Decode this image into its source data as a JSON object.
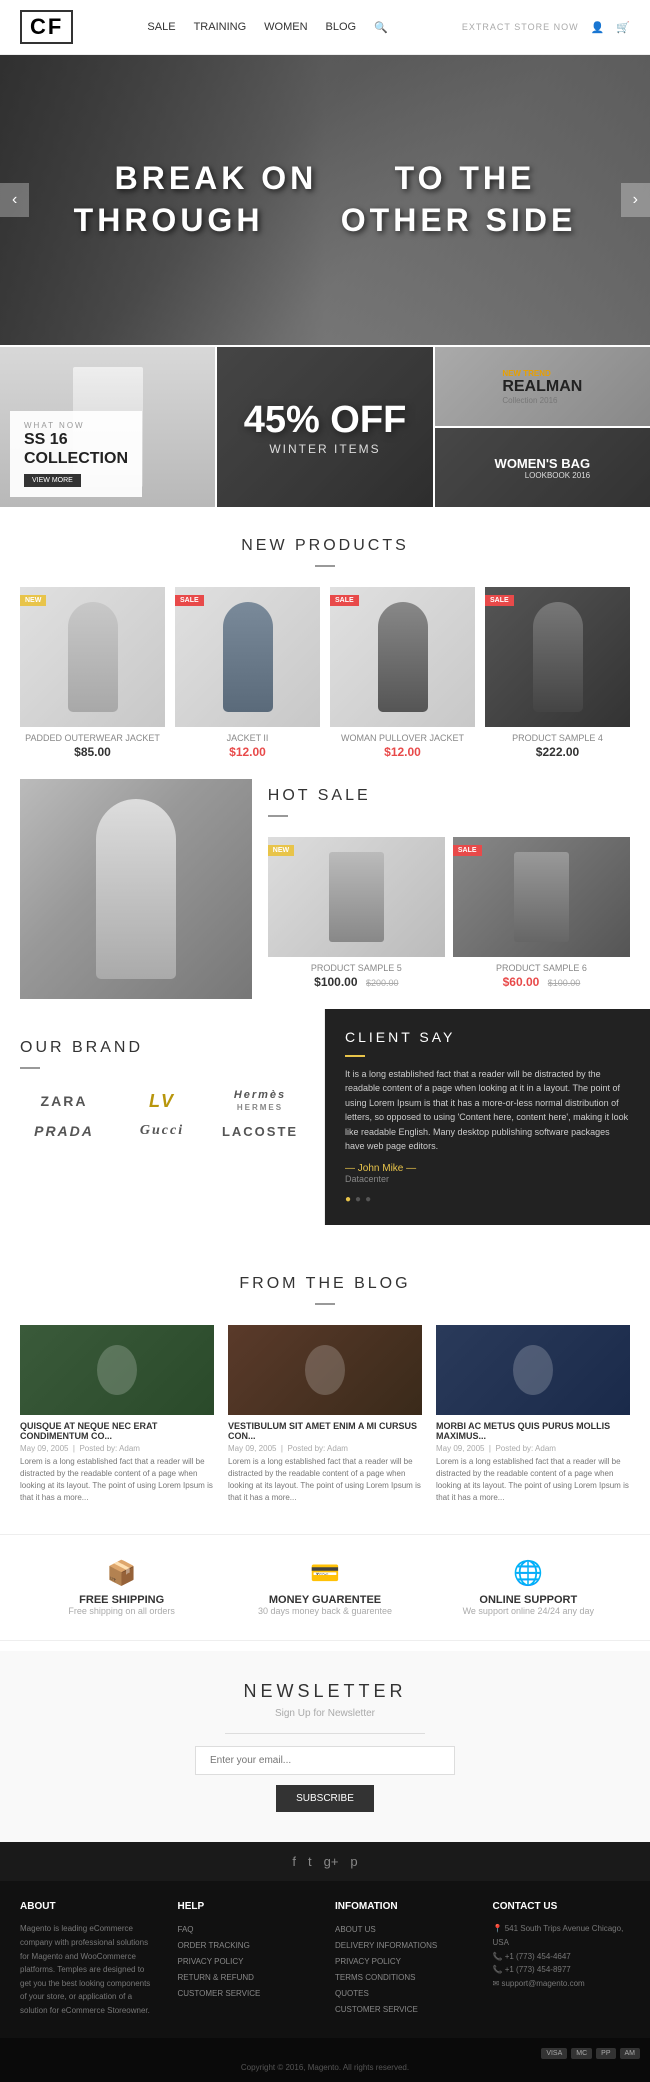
{
  "header": {
    "logo": "CF",
    "nav": [
      "SALE",
      "TRAINING",
      "WOMEN",
      "BLOG"
    ],
    "search_icon": "🔍",
    "right_links": [
      "EXTRACT STORE NOW"
    ],
    "user_icon": "👤",
    "cart_icon": "🛒"
  },
  "hero": {
    "line1": "BREAK ON",
    "line2": "TO THE",
    "line3": "THROUGH",
    "line4": "OTHER SIDE",
    "prev": "‹",
    "next": "›"
  },
  "promo": {
    "item1": {
      "badge": "WHAT NOW",
      "title": "SS 16\nCOLLECTION",
      "btn": "VIEW MORE"
    },
    "item2": {
      "percent": "45% OFF",
      "subtitle": "WINTER ITEMS"
    },
    "item3_top": {
      "new_trend": "NEW TREND",
      "title": "REALMAN",
      "subtitle": "Collection 2016"
    },
    "item3_bottom": {
      "title": "WOMEN'S BAG",
      "subtitle": "LOOKBOOK 2016"
    }
  },
  "new_products": {
    "title": "NEW PRODUCTS",
    "products": [
      {
        "name": "PADDED OUTERWEAR JACKET",
        "price": "$85.00",
        "sale": false,
        "tag": "NEW"
      },
      {
        "name": "JACKET II",
        "price": "$12.00",
        "sale": true,
        "tag": "SALE"
      },
      {
        "name": "WOMAN PULLOVER JACKET",
        "price": "$12.00",
        "sale": true,
        "tag": "SALE"
      },
      {
        "name": "PRODUCT SAMPLE 4",
        "price": "$222.00",
        "sale": false,
        "tag": "SALE"
      }
    ]
  },
  "hot_sale": {
    "title": "HOT SALE",
    "products": [
      {
        "name": "PRODUCT SAMPLE 5",
        "price": "$100.00",
        "old_price": "$200.00",
        "tag": "NEW"
      },
      {
        "name": "PRODUCT SAMPLE 6",
        "price": "$60.00",
        "old_price": "$100.00",
        "tag": "SALE"
      }
    ]
  },
  "our_brand": {
    "title": "OUR BRAND",
    "brands": [
      "ZARA",
      "LV",
      "HERMÈS",
      "PRADA",
      "GUCCI",
      "LACOSTE"
    ]
  },
  "client_say": {
    "title": "CLIENT SAY",
    "quote": "It is a long established fact that a reader will be distracted by the readable content of a page when looking at it in a layout. The point of using Lorem Ipsum is that it has a more-or-less normal distribution of letters, so opposed to using 'Content here, content here', making it look like readable English. Many desktop publishing software packages have web page editors.",
    "author": "— John Mike —",
    "role": "Datacenter",
    "dots": [
      "●",
      "○",
      "○"
    ]
  },
  "blog": {
    "title": "FROM THE BLOG",
    "posts": [
      {
        "title": "QUISQUE AT NEQUE NEC ERAT CONDIMENTUM CO...",
        "date": "May 09, 2005",
        "author": "Posted by: Adam",
        "excerpt": "Lorem is a long established fact that a reader will be distracted by the readable content of a page when looking at its layout. The point of using Lorem Ipsum is that it has a more..."
      },
      {
        "title": "VESTIBULUM SIT AMET ENIM A MI CURSUS CON...",
        "date": "May 09, 2005",
        "author": "Posted by: Adam",
        "excerpt": "Lorem is a long established fact that a reader will be distracted by the readable content of a page when looking at its layout. The point of using Lorem Ipsum is that it has a more..."
      },
      {
        "title": "MORBI AC METUS QUIS PURUS MOLLIS MAXIMUS...",
        "date": "May 09, 2005",
        "author": "Posted by: Adam",
        "excerpt": "Lorem is a long established fact that a reader will be distracted by the readable content of a page when looking at its layout. The point of using Lorem Ipsum is that it has a more..."
      }
    ]
  },
  "features": [
    {
      "icon": "📦",
      "title": "FREE SHIPPING",
      "desc": "Free shipping on all orders"
    },
    {
      "icon": "💳",
      "title": "MONEY GUARENTEE",
      "desc": "30 days money back & guarentee"
    },
    {
      "icon": "🌐",
      "title": "ONLINE SUPPORT",
      "desc": "We support online 24/24 any day"
    }
  ],
  "newsletter": {
    "title": "NEWSLETTER",
    "subtitle": "Sign Up for Newsletter",
    "placeholder": "Enter your email...",
    "btn": "SUBSCRIBE"
  },
  "footer": {
    "social_icons": [
      "f",
      "t",
      "g+",
      "p"
    ],
    "copyright": "Copyright © 2016, Magento. All rights reserved.",
    "columns": [
      {
        "title": "ABOUT",
        "text": "Magento is leading eCommerce company with professional solutions for Magento and WooCommerce platforms. Temples are designed to get you the best looking components of your store, or application of a solution for eCommerce Storeowner."
      },
      {
        "title": "HELP",
        "links": [
          "FAQ",
          "ORDER TRACKING",
          "PRIVACY POLICY",
          "RETURN & REFUND",
          "CUSTOMER SERVICE"
        ]
      },
      {
        "title": "INFOMATION",
        "links": [
          "ABOUT US",
          "DELIVERY INFORMATIONS",
          "PRIVACY POLICY",
          "TERMS CONDITIONS",
          "QUOTES",
          "CUSTOMER SERVICE"
        ]
      },
      {
        "title": "CONTACT US",
        "address": "541 South Trips Avenue Chicago, USA",
        "phone": "+1 (773) 454-4647",
        "phone2": "+1 (773) 454-8977",
        "email": "support@magento.com"
      }
    ],
    "payment_icons": [
      "VISA",
      "MC",
      "PP",
      "AM"
    ]
  }
}
